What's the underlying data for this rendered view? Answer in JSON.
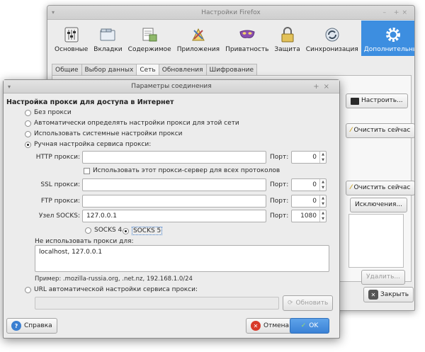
{
  "bg_window": {
    "title": "Настройки Firefox",
    "panes": [
      {
        "label": "Основные"
      },
      {
        "label": "Вкладки"
      },
      {
        "label": "Содержимое"
      },
      {
        "label": "Приложения"
      },
      {
        "label": "Приватность"
      },
      {
        "label": "Защита"
      },
      {
        "label": "Синхронизация"
      },
      {
        "label": "Дополнительные"
      }
    ],
    "tabs": [
      "Общие",
      "Выбор данных",
      "Сеть",
      "Обновления",
      "Шифрование"
    ],
    "buttons": {
      "configure": "Настроить...",
      "clear_now_1": "Очистить сейчас",
      "clear_now_2": "Очистить сейчас",
      "exceptions": "Исключения...",
      "delete": "Удалить...",
      "close": "Закрыть"
    }
  },
  "dialog": {
    "title": "Параметры соединения",
    "heading": "Настройка прокси для доступа в Интернет",
    "options": {
      "no_proxy": "Без прокси",
      "auto_detect": "Автоматически определять настройки прокси для этой сети",
      "system": "Использовать системные настройки прокси",
      "manual": "Ручная настройка сервиса прокси:",
      "pac": "URL автоматической настройки сервиса прокси:"
    },
    "http_label": "HTTP прокси:",
    "http_value": "",
    "http_port": "0",
    "same_proxy_label": "Использовать этот прокси-сервер для всех протоколов",
    "ssl_label": "SSL прокси:",
    "ssl_value": "",
    "ssl_port": "0",
    "ftp_label": "FTP прокси:",
    "ftp_value": "",
    "ftp_port": "0",
    "socks_label": "Узел SOCKS:",
    "socks_value": "127.0.0.1",
    "socks_port": "1080",
    "port_label": "Порт:",
    "socks4": "SOCKS 4",
    "socks5": "SOCKS 5",
    "no_proxy_for_label": "Не использовать прокси для:",
    "no_proxy_for_value": "localhost, 127.0.0.1",
    "example": "Пример: .mozilla-russia.org, .net.nz, 192.168.1.0/24",
    "pac_value": "",
    "reload": "Обновить",
    "help": "Справка",
    "cancel": "Отмена",
    "ok": "OK"
  }
}
